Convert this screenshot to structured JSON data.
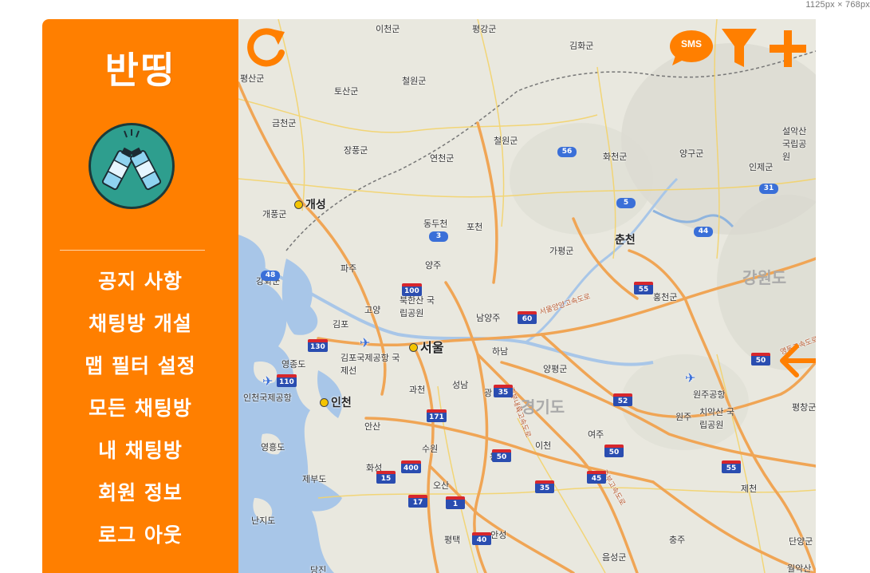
{
  "viewer": {
    "dimension_label": "1125px × 768px"
  },
  "sidebar": {
    "brand": "반띵",
    "logo_icon": "beverage-toast-icon",
    "menu": [
      {
        "label": "공지 사항"
      },
      {
        "label": "채팅방 개설"
      },
      {
        "label": "맵 필터 설정"
      },
      {
        "label": "모든 채팅방"
      },
      {
        "label": "내 채팅방"
      },
      {
        "label": "회원 정보"
      },
      {
        "label": "로그 아웃"
      }
    ]
  },
  "toolbar": {
    "refresh_icon": "refresh-icon",
    "sms_label": "SMS",
    "filter_icon": "filter-icon",
    "add_icon": "plus-icon",
    "back_icon": "arrow-left-icon"
  },
  "map": {
    "regions": [
      "강원도",
      "경기도"
    ],
    "cities": [
      "개성",
      "서울",
      "인천"
    ],
    "labels": [
      "이천군",
      "평강군",
      "김화군",
      "평산군",
      "토산군",
      "철원군",
      "금천군",
      "장풍군",
      "연천군",
      "철원군",
      "화천군",
      "양구군",
      "인제군",
      "설악산 국립공원",
      "개풍군",
      "동두천",
      "포천",
      "가평군",
      "춘천",
      "파주",
      "양주",
      "강화군",
      "고양",
      "북한산 국립공원",
      "남양주",
      "홍천군",
      "김포",
      "김포국제공항 국제선",
      "하남",
      "양평군",
      "영종도",
      "인천국제공항",
      "과천",
      "성남",
      "광",
      "원주공항",
      "안산",
      "원주",
      "치악산 국립공원",
      "평창군",
      "영흥도",
      "수원",
      "용인",
      "이천",
      "여주",
      "화성",
      "제부도",
      "오산",
      "제천",
      "난지도",
      "평택",
      "안성",
      "충주",
      "음성군",
      "단양군",
      "당진",
      "월악산",
      "서울양양고속도로",
      "영동고속도로",
      "중부내륙고속도로",
      "중부고속도로"
    ],
    "routes": [
      "56",
      "3",
      "5",
      "31",
      "44",
      "48",
      "130",
      "100",
      "60",
      "55",
      "110",
      "35",
      "50",
      "52",
      "171",
      "400",
      "15",
      "17",
      "1",
      "40",
      "45"
    ]
  },
  "colors": {
    "accent": "#ff7f00",
    "map_land": "#e9e8df",
    "water": "#a8c6e8",
    "highway": "#f0a555",
    "logo_bg": "#2e9e8e"
  }
}
